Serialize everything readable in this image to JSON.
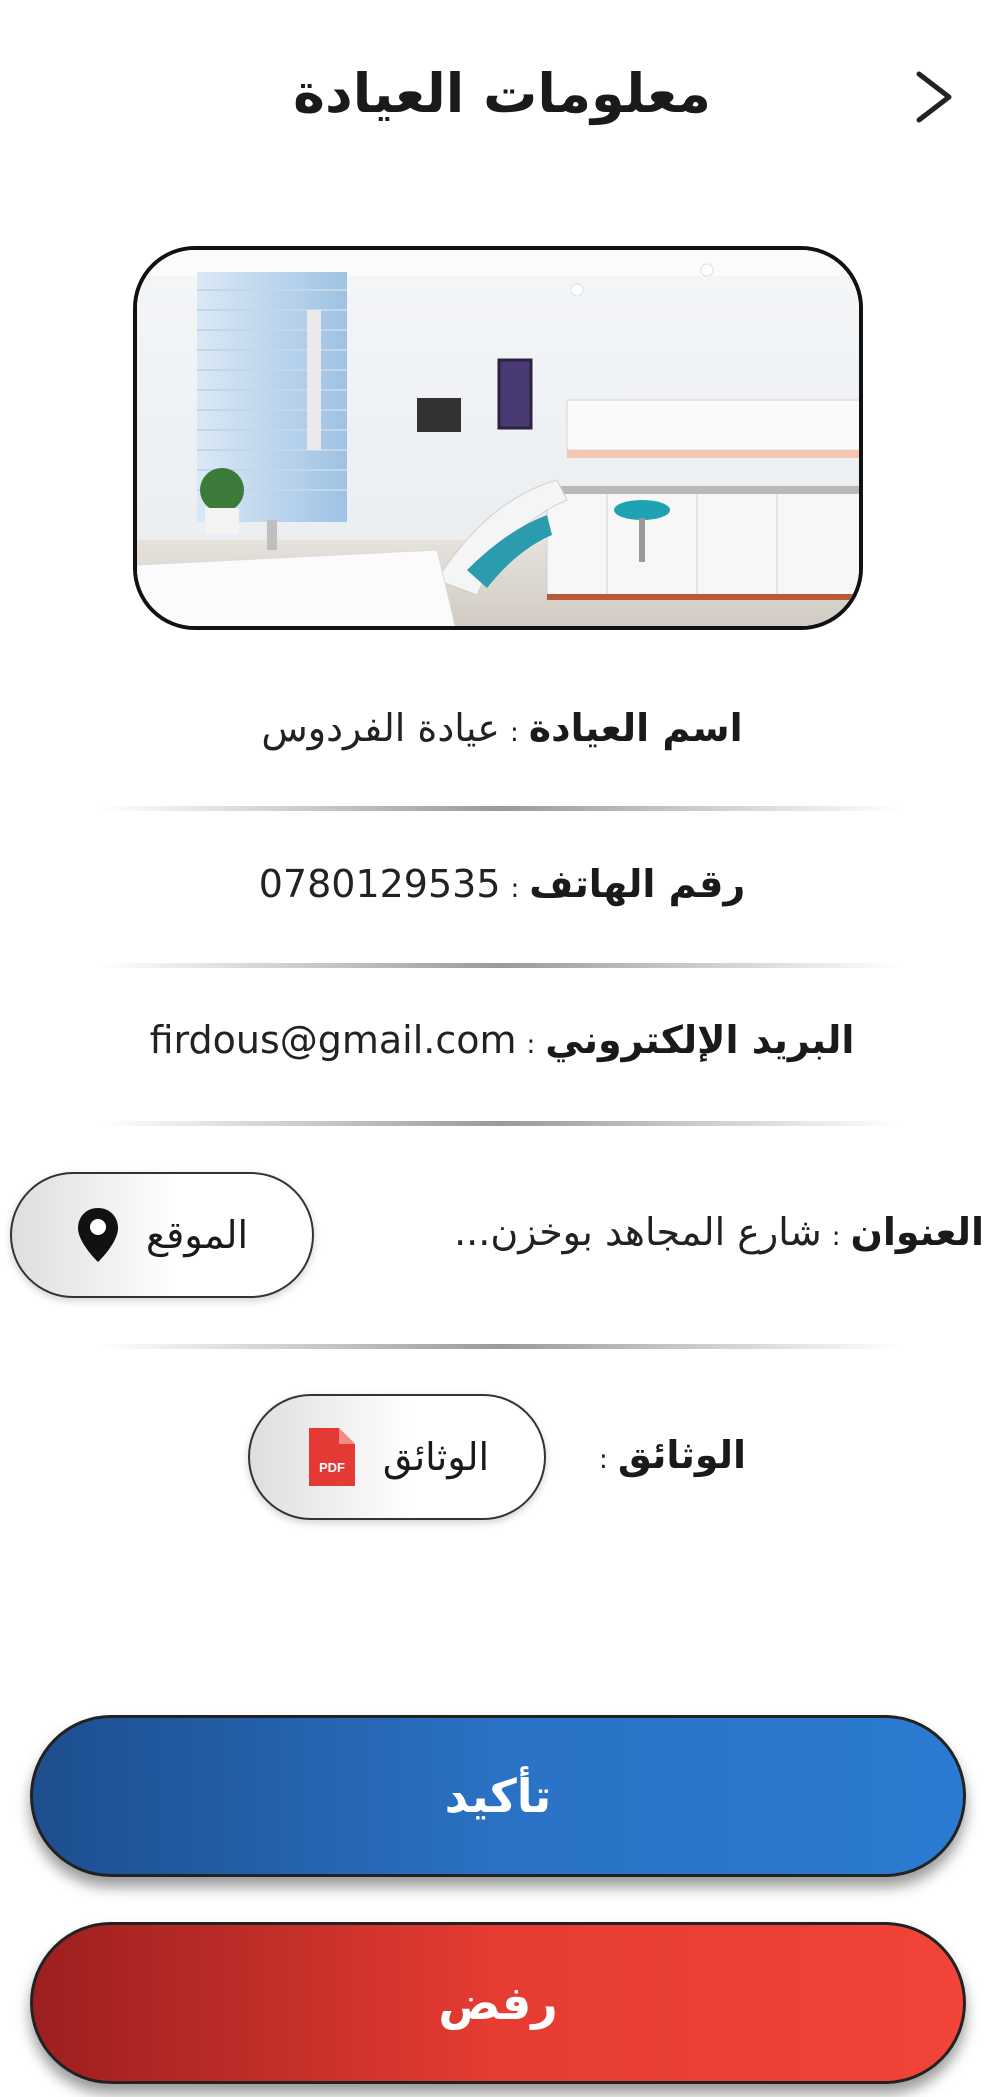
{
  "header": {
    "title": "معلومات العيادة",
    "back_icon": "chevron-right-icon"
  },
  "clinic_photo": {
    "alt": "صورة العيادة"
  },
  "info": {
    "separator": ":",
    "name": {
      "label": "اسم العيادة",
      "value": "عيادة الفردوس"
    },
    "phone": {
      "label": "رقم الهاتف",
      "value": "0780129535"
    },
    "email": {
      "label": "البريد الإلكتروني",
      "value": "firdous@gmail.com"
    },
    "address": {
      "label": "العنوان",
      "value": "شارع المجاهد بوخزن...",
      "location_button": "الموقع",
      "location_icon": "map-pin-icon"
    },
    "documents": {
      "label": "الوثائق",
      "button": "الوثائق",
      "pdf_icon_text": "PDF",
      "icon": "pdf-file-icon"
    }
  },
  "actions": {
    "confirm": "تأكيد",
    "reject": "رفض"
  },
  "colors": {
    "confirm": "#2a72c4",
    "reject": "#e63c32",
    "pdf_icon": "#e53935"
  }
}
